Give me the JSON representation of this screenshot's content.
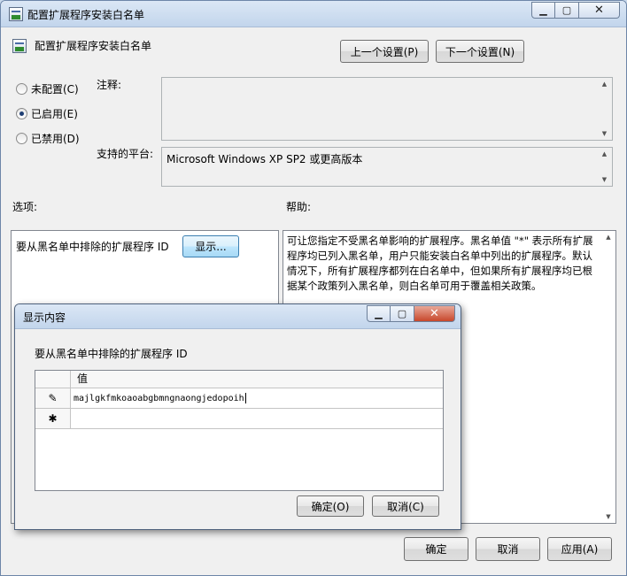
{
  "window": {
    "title": "配置扩展程序安装白名单",
    "header_title": "配置扩展程序安装白名单",
    "prev_button": "上一个设置(P)",
    "next_button": "下一个设置(N)",
    "radio": {
      "not_configured": "未配置(C)",
      "enabled": "已启用(E)",
      "disabled": "已禁用(D)",
      "selected": "enabled"
    },
    "comment_label": "注释:",
    "comment_value": "",
    "platform_label": "支持的平台:",
    "platform_value": "Microsoft Windows XP SP2 或更高版本",
    "options_label": "选项:",
    "help_label": "帮助:",
    "option_text": "要从黑名单中排除的扩展程序 ID",
    "show_button": "显示...",
    "help_text": "可让您指定不受黑名单影响的扩展程序。黑名单值 \"*\" 表示所有扩展程序均已列入黑名单，用户只能安装白名单中列出的扩展程序。默认情况下，所有扩展程序都列在白名单中，但如果所有扩展程序均已根据某个政策列入黑名单，则白名单可用于覆盖相关政策。",
    "ok_button": "确定",
    "cancel_button": "取消",
    "apply_button": "应用(A)"
  },
  "dialog": {
    "title": "显示内容",
    "subtitle": "要从黑名单中排除的扩展程序 ID",
    "column_header": "值",
    "rows": [
      {
        "marker": "✎",
        "value": "majlgkfmkoaoabgbmngnaongjedopoih"
      },
      {
        "marker": "✱",
        "value": ""
      }
    ],
    "ok_button": "确定(O)",
    "cancel_button": "取消(C)"
  },
  "colors": {
    "window_bg": "#f0f0f0",
    "titlebar": "#c2d5ec",
    "close_button": "#c8472b"
  }
}
